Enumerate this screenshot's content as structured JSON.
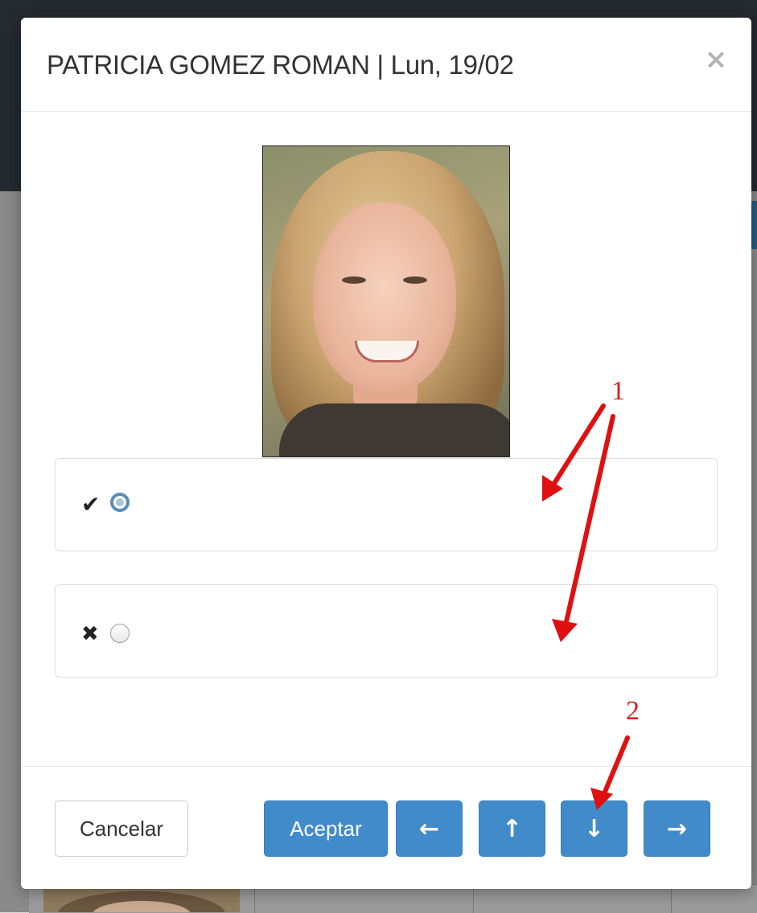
{
  "modal": {
    "title": "PATRICIA GOMEZ ROMAN | Lun, 19/02",
    "close_label": "×"
  },
  "options": [
    {
      "icon": "check-icon",
      "glyph": "✔",
      "selected": true
    },
    {
      "icon": "cross-icon",
      "glyph": "✖",
      "selected": false
    }
  ],
  "footer": {
    "cancel_label": "Cancelar",
    "accept_label": "Aceptar",
    "left_glyph": "←",
    "up_glyph": "↑",
    "down_glyph": "↓",
    "right_glyph": "→"
  },
  "annotations": {
    "label_1": "1",
    "label_2": "2"
  },
  "colors": {
    "primary": "#428bca",
    "annotation": "#e01010",
    "radio_selected": "#5b8db8"
  }
}
